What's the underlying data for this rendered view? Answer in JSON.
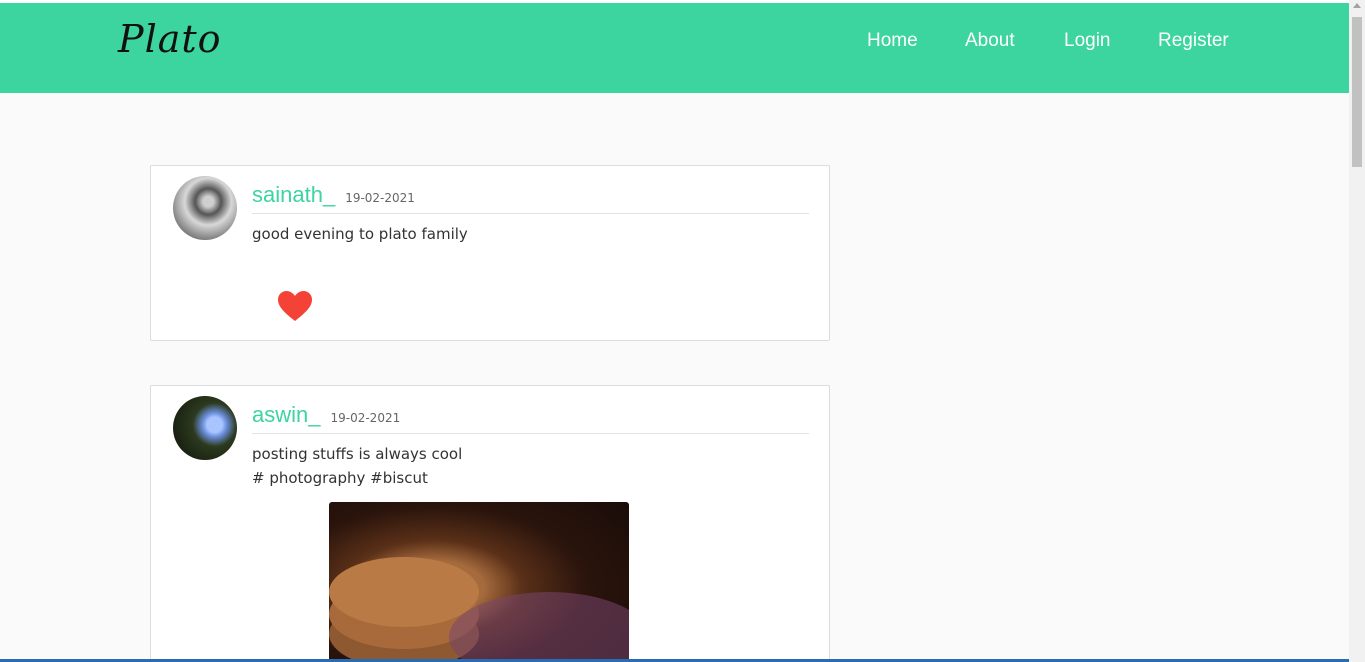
{
  "brand": {
    "name": "Plato"
  },
  "nav": {
    "home": "Home",
    "about": "About",
    "login": "Login",
    "register": "Register"
  },
  "posts": [
    {
      "username": "sainath_",
      "date": "19-02-2021",
      "text": "good evening to plato family",
      "tags": "",
      "liked": true,
      "like_color": "#f44336"
    },
    {
      "username": "aswin_",
      "date": "19-02-2021",
      "text": "posting stuffs is always cool",
      "tags": "# photography #biscut"
    }
  ],
  "colors": {
    "accent": "#3cd49f",
    "background": "#fafafa"
  }
}
